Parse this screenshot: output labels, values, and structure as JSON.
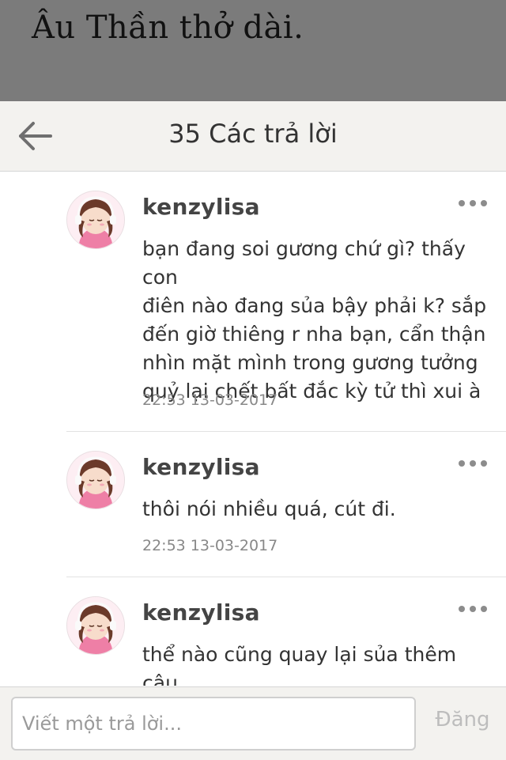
{
  "background": {
    "text": "Âu Thần thở dài."
  },
  "header": {
    "back_icon": "arrow-left-icon",
    "title": "35 Các trả lời"
  },
  "replies": [
    {
      "username": "kenzylisa",
      "avatar": "girl-headphones-avatar",
      "content": "bạn đang soi gương chứ gì? thấy con\nđiên nào đang sủa bậy phải k? sắp\nđến giờ thiêng r nha bạn, cẩn thận\nnhìn mặt mình trong gương tưởng\nquỷ lại chết bất đắc kỳ tử thì xui à",
      "timestamp": "22:53 13-03-2017"
    },
    {
      "username": "kenzylisa",
      "avatar": "girl-headphones-avatar",
      "content": "thôi nói nhiều quá, cút đi.",
      "timestamp": "22:53 13-03-2017"
    },
    {
      "username": "kenzylisa",
      "avatar": "girl-headphones-avatar",
      "content": "thể nào cũng quay lại sủa thêm câu\nnữa cho xem hahaha, bản năng của",
      "timestamp": ""
    }
  ],
  "composer": {
    "placeholder": "Viết một trả lời...",
    "post_label": "Đăng"
  },
  "colors": {
    "header_bg": "#f3f2ef",
    "overlay_bg": "#7b7b7b",
    "text": "#333333",
    "muted": "#888888",
    "disabled": "#bdbdbd"
  }
}
